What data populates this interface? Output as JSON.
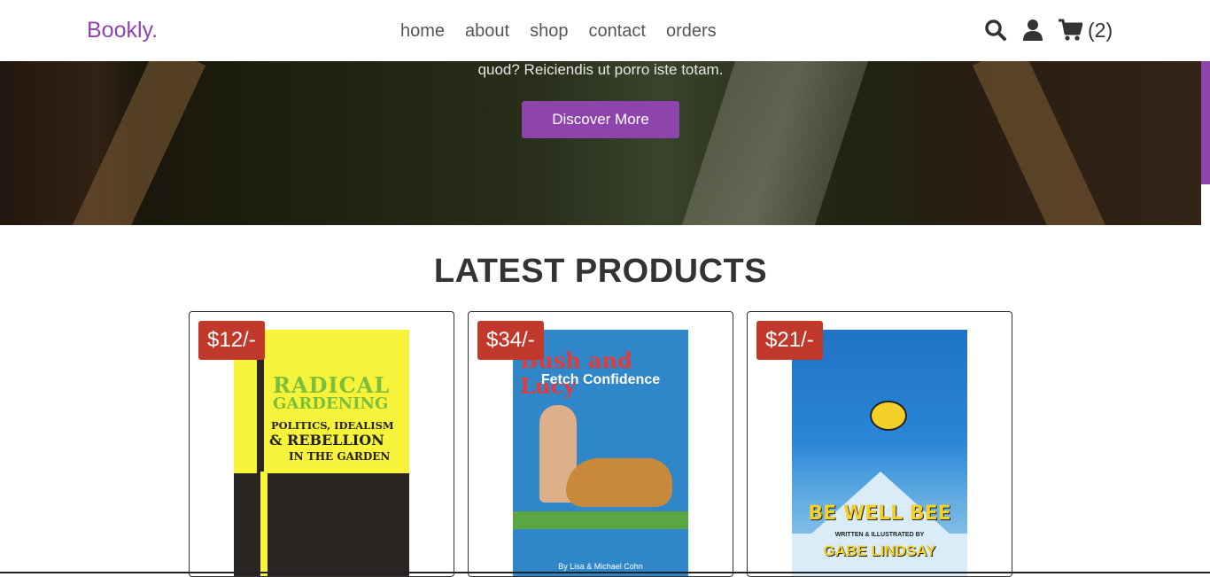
{
  "header": {
    "logo": "Bookly.",
    "nav": [
      "home",
      "about",
      "shop",
      "contact",
      "orders"
    ],
    "icons": [
      "search-icon",
      "user-icon",
      "cart-icon"
    ],
    "cart_count": "(2)"
  },
  "hero": {
    "text": "quod? Reiciendis ut porro iste totam.",
    "button": "Discover More"
  },
  "section": {
    "title": "LATEST PRODUCTS"
  },
  "products": [
    {
      "price": "$12/-",
      "cover_lines": [
        "RADICAL",
        "GARDENING",
        "POLITICS, IDEALISM",
        "& REBELLION",
        "IN THE GARDEN"
      ]
    },
    {
      "price": "$34/-",
      "cover_lines": [
        "Bush and Lucy",
        "Fetch Confidence",
        "By Lisa & Michael Cohn"
      ]
    },
    {
      "price": "$21/-",
      "cover_lines": [
        "BE WELL BEE",
        "WRITTEN & ILLUSTRATED BY",
        "GABE LINDSAY"
      ]
    }
  ],
  "colors": {
    "accent": "#8e44ad",
    "price_badge": "#c0392b"
  }
}
